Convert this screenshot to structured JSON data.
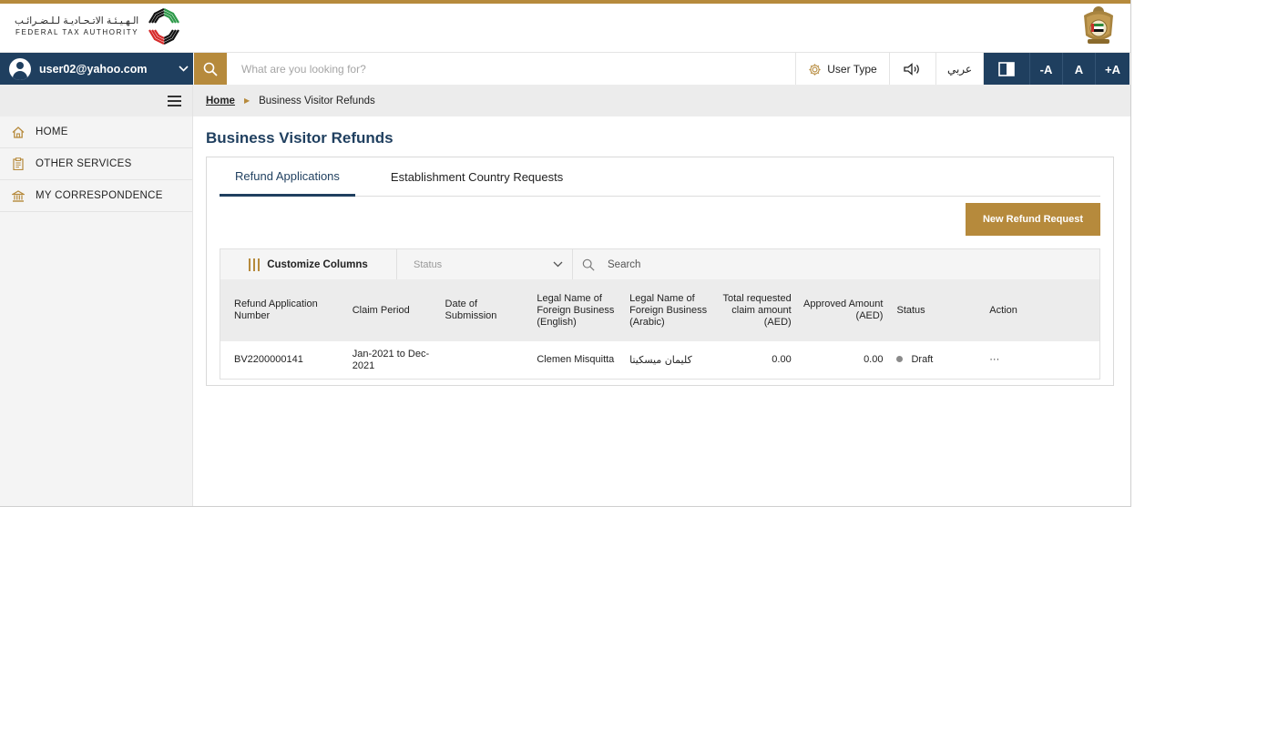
{
  "header": {
    "logo_arabic": "الـهـيـئـة الاتـحـاديـة لـلـضـرائـب",
    "logo_english": "FEDERAL TAX AUTHORITY"
  },
  "toolbar": {
    "user_email": "user02@yahoo.com",
    "search_placeholder": "What are you looking for?",
    "user_type_label": "User Type",
    "language_label": "عربي",
    "font_decrease": "-A",
    "font_normal": "A",
    "font_increase": "+A"
  },
  "sidebar": {
    "items": [
      {
        "label": "HOME",
        "icon": "home-icon"
      },
      {
        "label": "OTHER SERVICES",
        "icon": "clipboard-icon"
      },
      {
        "label": "MY CORRESPONDENCE",
        "icon": "building-icon"
      }
    ]
  },
  "breadcrumb": {
    "home": "Home",
    "current": "Business Visitor Refunds"
  },
  "page": {
    "title": "Business Visitor Refunds",
    "tabs": [
      "Refund Applications",
      "Establishment Country Requests"
    ],
    "active_tab": "Refund Applications",
    "new_button": "New Refund Request"
  },
  "grid": {
    "customize_label": "Customize Columns",
    "status_placeholder": "Status",
    "search_placeholder": "Search",
    "headers": [
      "Refund Application Number",
      "Claim Period",
      "Date of Submission",
      "Legal Name of Foreign Business (English)",
      "Legal Name of Foreign Business (Arabic)",
      "Total requested claim amount (AED)",
      "Approved Amount (AED)",
      "Status",
      "Action"
    ],
    "rows": [
      {
        "number": "BV2200000141",
        "period": "Jan-2021 to Dec-2021",
        "submission": "",
        "name_en": "Clemen Misquitta",
        "name_ar": "كليمان ميسكيتا",
        "total": "0.00",
        "approved": "0.00",
        "status": "Draft",
        "action": "···"
      }
    ]
  },
  "colors": {
    "primary": "#1f3f5f",
    "accent": "#b68a3c",
    "status_draft": "#8a8a8a"
  }
}
